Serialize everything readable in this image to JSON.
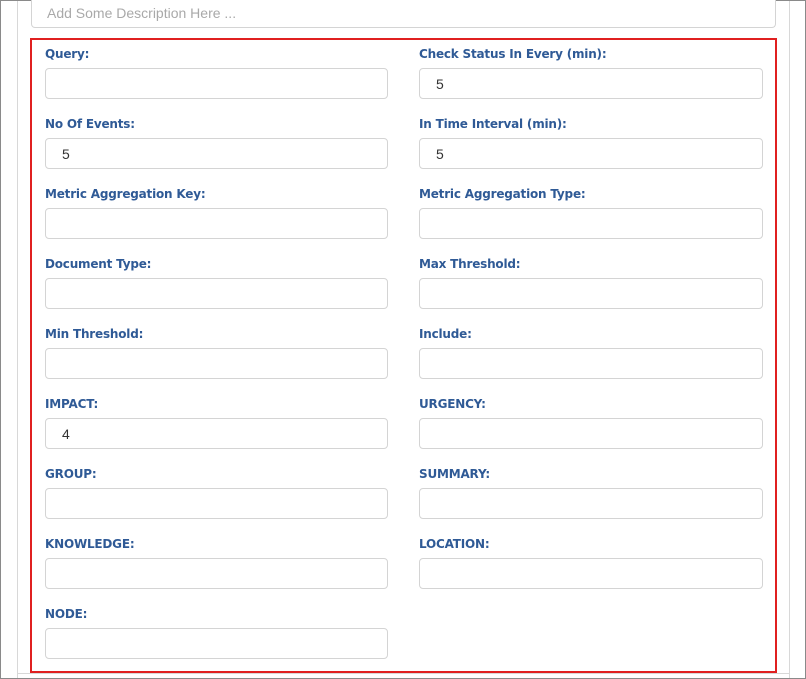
{
  "description": {
    "placeholder": "Add Some Description Here ..."
  },
  "form": {
    "query": {
      "label": "Query:",
      "value": ""
    },
    "check_status": {
      "label": "Check Status In Every (min):",
      "value": "5"
    },
    "no_of_events": {
      "label": "No Of Events:",
      "value": "5"
    },
    "time_interval": {
      "label": "In Time Interval (min):",
      "value": "5"
    },
    "metric_key": {
      "label": "Metric Aggregation Key:",
      "value": ""
    },
    "metric_type": {
      "label": "Metric Aggregation Type:",
      "value": ""
    },
    "document_type": {
      "label": "Document Type:",
      "value": ""
    },
    "max_threshold": {
      "label": "Max Threshold:",
      "value": ""
    },
    "min_threshold": {
      "label": "Min Threshold:",
      "value": ""
    },
    "include": {
      "label": "Include:",
      "value": ""
    },
    "impact": {
      "label": "IMPACT:",
      "value": "4"
    },
    "urgency": {
      "label": "URGENCY:",
      "value": ""
    },
    "group": {
      "label": "GROUP:",
      "value": ""
    },
    "summary": {
      "label": "SUMMARY:",
      "value": ""
    },
    "knowledge": {
      "label": "KNOWLEDGE:",
      "value": ""
    },
    "location": {
      "label": "LOCATION:",
      "value": ""
    },
    "node": {
      "label": "NODE:",
      "value": ""
    }
  },
  "colors": {
    "label": "#2f5a96",
    "highlight_border": "#e02020",
    "input_border": "#d4d4d4"
  }
}
